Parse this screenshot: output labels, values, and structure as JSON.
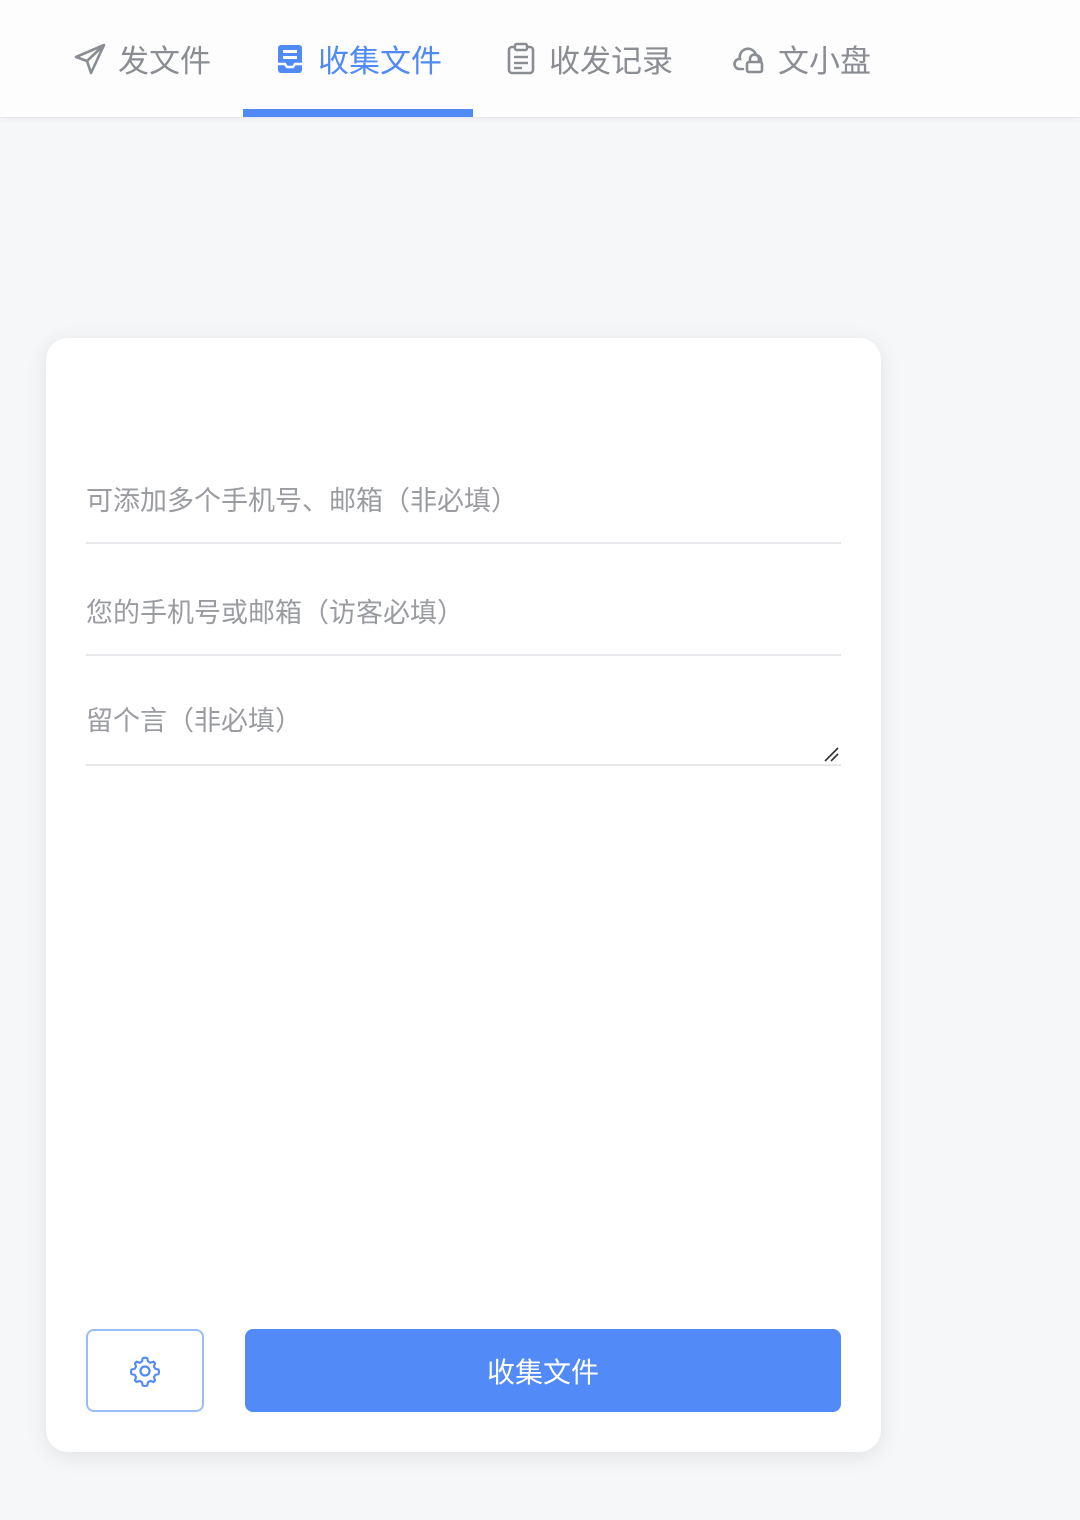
{
  "nav": {
    "tabs": [
      {
        "label": "发文件",
        "icon": "paper-plane-icon",
        "active": false
      },
      {
        "label": "收集文件",
        "icon": "inbox-icon",
        "active": true
      },
      {
        "label": "收发记录",
        "icon": "clipboard-icon",
        "active": false
      },
      {
        "label": "文小盘",
        "icon": "cloud-lock-icon",
        "active": false
      }
    ]
  },
  "form": {
    "recipients_placeholder": "可添加多个手机号、邮箱（非必填）",
    "contact_placeholder": "您的手机号或邮箱（访客必填）",
    "message_placeholder": "留个言（非必填）",
    "settings_icon": "gear-icon",
    "submit_label": "收集文件"
  },
  "colors": {
    "accent": "#528bf8",
    "inactive_text": "#8a8d93",
    "background": "#f6f7f9",
    "card": "#ffffff"
  }
}
